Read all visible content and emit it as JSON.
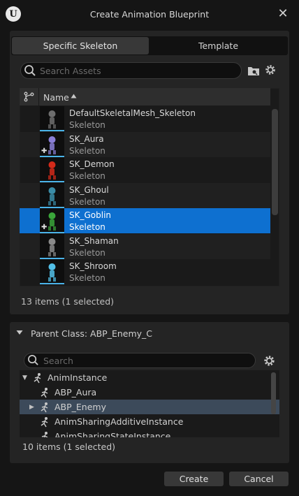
{
  "dialog": {
    "title": "Create Animation Blueprint",
    "close_glyph": "✕"
  },
  "tabs": [
    {
      "label": "Specific Skeleton",
      "active": true
    },
    {
      "label": "Template",
      "active": false
    }
  ],
  "search": {
    "placeholder": "Search Assets"
  },
  "asset_list": {
    "column_name": "Name",
    "items": [
      {
        "name": "DefaultSkeletalMesh_Skeleton",
        "type": "Skeleton",
        "selected": false,
        "plus": false,
        "thumb_color": "#6e6e6e"
      },
      {
        "name": "SK_Aura",
        "type": "Skeleton",
        "selected": false,
        "plus": true,
        "thumb_color": "#8a7fd6"
      },
      {
        "name": "SK_Demon",
        "type": "Skeleton",
        "selected": false,
        "plus": false,
        "thumb_color": "#d42a1a"
      },
      {
        "name": "SK_Ghoul",
        "type": "Skeleton",
        "selected": false,
        "plus": false,
        "thumb_color": "#3a8ca6"
      },
      {
        "name": "SK_Goblin",
        "type": "Skeleton",
        "selected": true,
        "plus": true,
        "thumb_color": "#3aa53a"
      },
      {
        "name": "SK_Shaman",
        "type": "Skeleton",
        "selected": false,
        "plus": false,
        "thumb_color": "#8a8a8a"
      },
      {
        "name": "SK_Shroom",
        "type": "Skeleton",
        "selected": false,
        "plus": false,
        "thumb_color": "#52c0e8"
      }
    ],
    "count_text": "13 items (1 selected)"
  },
  "parent_class": {
    "label": "Parent Class: ABP_Enemy_C",
    "search_placeholder": "Search",
    "tree": [
      {
        "label": "AnimInstance",
        "expanded": true,
        "selected": false,
        "indent": 0,
        "has_arrow": true
      },
      {
        "label": "ABP_Aura",
        "expanded": false,
        "selected": false,
        "indent": 1,
        "has_arrow": false
      },
      {
        "label": "ABP_Enemy",
        "expanded": false,
        "selected": true,
        "indent": 1,
        "has_arrow": true
      },
      {
        "label": "AnimSharingAdditiveInstance",
        "expanded": false,
        "selected": false,
        "indent": 1,
        "has_arrow": false
      },
      {
        "label": "AnimSharingStateInstance",
        "expanded": false,
        "selected": false,
        "indent": 1,
        "has_arrow": false
      }
    ],
    "count_text": "10 items (1 selected)"
  },
  "buttons": {
    "create": "Create",
    "cancel": "Cancel"
  },
  "colors": {
    "selection_blue": "#0e70d0",
    "tree_selection": "#3c4a5a",
    "thumb_accent": "#4ab3e8"
  }
}
